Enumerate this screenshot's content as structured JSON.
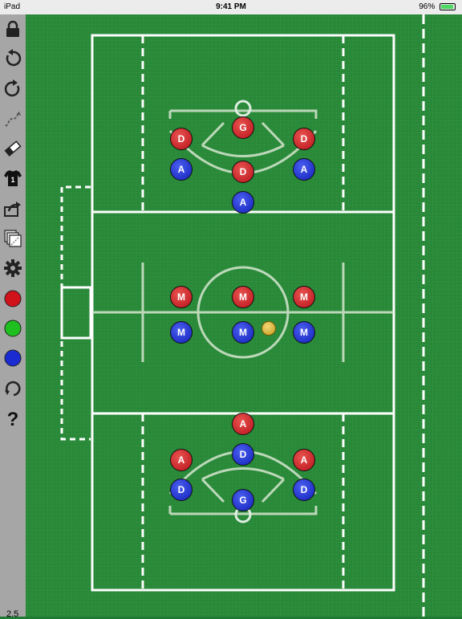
{
  "status_bar": {
    "device": "iPad",
    "time": "9:41 PM",
    "battery": "96%",
    "battery_fraction": 0.96
  },
  "toolbar": {
    "tools": [
      {
        "icon": "lock-icon"
      },
      {
        "icon": "undo-icon"
      },
      {
        "icon": "redo-icon"
      },
      {
        "icon": "draw-path-icon"
      },
      {
        "icon": "eraser-icon"
      },
      {
        "icon": "jersey-number-icon",
        "label": "1"
      },
      {
        "icon": "share-icon"
      },
      {
        "icon": "plays-icon"
      },
      {
        "icon": "settings-icon"
      },
      {
        "icon": "red-team-icon",
        "color": "#d0121b"
      },
      {
        "icon": "green-team-icon",
        "color": "#1fbf1f"
      },
      {
        "icon": "blue-team-icon",
        "color": "#1a2bd1"
      },
      {
        "icon": "reset-icon"
      },
      {
        "icon": "help-icon"
      }
    ],
    "version": "2.5"
  },
  "players": [
    {
      "label": "G",
      "team": "red"
    },
    {
      "label": "D",
      "team": "red"
    },
    {
      "label": "D",
      "team": "red"
    },
    {
      "label": "A",
      "team": "blue"
    },
    {
      "label": "D",
      "team": "red"
    },
    {
      "label": "A",
      "team": "blue"
    },
    {
      "label": "A",
      "team": "blue"
    },
    {
      "label": "M",
      "team": "red"
    },
    {
      "label": "M",
      "team": "red"
    },
    {
      "label": "M",
      "team": "red"
    },
    {
      "label": "M",
      "team": "blue"
    },
    {
      "label": "M",
      "team": "blue"
    },
    {
      "label": "M",
      "team": "blue"
    },
    {
      "label": "A",
      "team": "red"
    },
    {
      "label": "D",
      "team": "blue"
    },
    {
      "label": "A",
      "team": "red"
    },
    {
      "label": "A",
      "team": "red"
    },
    {
      "label": "D",
      "team": "blue"
    },
    {
      "label": "D",
      "team": "blue"
    },
    {
      "label": "G",
      "team": "blue"
    }
  ],
  "colors": {
    "red": "#d0121b",
    "blue": "#1a2bd1",
    "field": "#2a8d3a",
    "ball": "#e0bb3c"
  }
}
